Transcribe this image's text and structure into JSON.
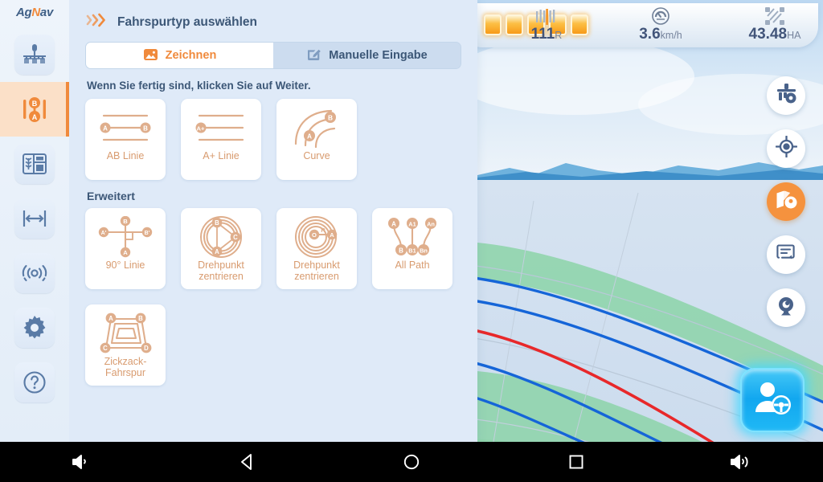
{
  "brand": {
    "part1": "Ag",
    "part2": "N",
    "part3": "av"
  },
  "sidebar": {
    "items": [
      {
        "icon": "sprayer-boom-icon",
        "name": "sidebar-item-machine",
        "active": false
      },
      {
        "icon": "ab-line-icon",
        "name": "sidebar-item-guidance",
        "active": true
      },
      {
        "icon": "field-icon",
        "name": "sidebar-item-field",
        "active": false
      },
      {
        "icon": "swath-width-icon",
        "name": "sidebar-item-width",
        "active": false
      },
      {
        "icon": "signal-icon",
        "name": "sidebar-item-signal",
        "active": false
      },
      {
        "icon": "gear-icon",
        "name": "sidebar-item-settings",
        "active": false
      },
      {
        "icon": "help-icon",
        "name": "sidebar-item-help",
        "active": false
      }
    ]
  },
  "panel": {
    "title": "Fahrspurtyp auswählen",
    "header_icon": "chevrons-right-icon",
    "tabs": [
      {
        "label": "Zeichnen",
        "icon": "image-icon",
        "active": true
      },
      {
        "label": "Manuelle Eingabe",
        "icon": "pencil-edit-icon",
        "active": false
      }
    ],
    "hint": "Wenn Sie fertig sind, klicken Sie auf Weiter.",
    "basic_patterns": [
      {
        "label": "AB Linie",
        "icon": "ab-line-pattern-icon"
      },
      {
        "label": "A+ Linie",
        "icon": "a-plus-line-pattern-icon"
      },
      {
        "label": "Curve",
        "icon": "curve-pattern-icon"
      }
    ],
    "advanced_title": "Erweitert",
    "advanced_patterns": [
      {
        "label": "90° Linie",
        "icon": "ninety-degree-line-pattern-icon"
      },
      {
        "label": "Drehpunkt zentrieren",
        "icon": "pivot-center-triangle-pattern-icon"
      },
      {
        "label": "Drehpunkt zentrieren",
        "icon": "pivot-center-radius-pattern-icon"
      },
      {
        "label": "All Path",
        "icon": "all-path-pattern-icon"
      },
      {
        "label": "Zickzack-Fahrspur",
        "icon": "zigzag-pattern-icon"
      }
    ]
  },
  "status_bar": {
    "battery_cells": 5,
    "stats": [
      {
        "name": "gps-accuracy",
        "icon": "signal-bars-icon",
        "value": "111",
        "unit": "R"
      },
      {
        "name": "speed",
        "icon": "speedometer-icon",
        "value": "3.6",
        "unit": "km/h"
      },
      {
        "name": "area",
        "icon": "area-icon",
        "value": "43.48",
        "unit": "HA"
      }
    ]
  },
  "map_rail": [
    {
      "name": "map-button-machine-settings",
      "icon": "machine-settings-icon",
      "active": false
    },
    {
      "name": "map-button-locate",
      "icon": "crosshair-locate-icon",
      "active": false
    },
    {
      "name": "map-button-map-layers",
      "icon": "map-pin-layer-icon",
      "active": true
    },
    {
      "name": "map-button-notes",
      "icon": "note-refresh-icon",
      "active": false
    },
    {
      "name": "map-button-camera",
      "icon": "camera-icon",
      "active": false
    }
  ],
  "driver_button": {
    "name": "driver-mode-button",
    "icon": "driver-steering-icon"
  },
  "android_nav": [
    {
      "name": "volume-down-button",
      "icon": "volume-down-icon"
    },
    {
      "name": "back-button",
      "icon": "back-triangle-icon"
    },
    {
      "name": "home-button",
      "icon": "home-circle-icon"
    },
    {
      "name": "recents-button",
      "icon": "recents-square-icon"
    },
    {
      "name": "volume-up-button",
      "icon": "volume-up-icon"
    }
  ],
  "colors": {
    "accent_orange": "#f08a3c",
    "panel_bg": "#dfeaf8",
    "card_label": "#d89b6f",
    "text_blue": "#3c5777",
    "guidance_blue": "#1565d8",
    "guidance_red": "#e8282a",
    "swath_green": "#8cd4a8",
    "driver_cyan": "#12a7ef"
  }
}
